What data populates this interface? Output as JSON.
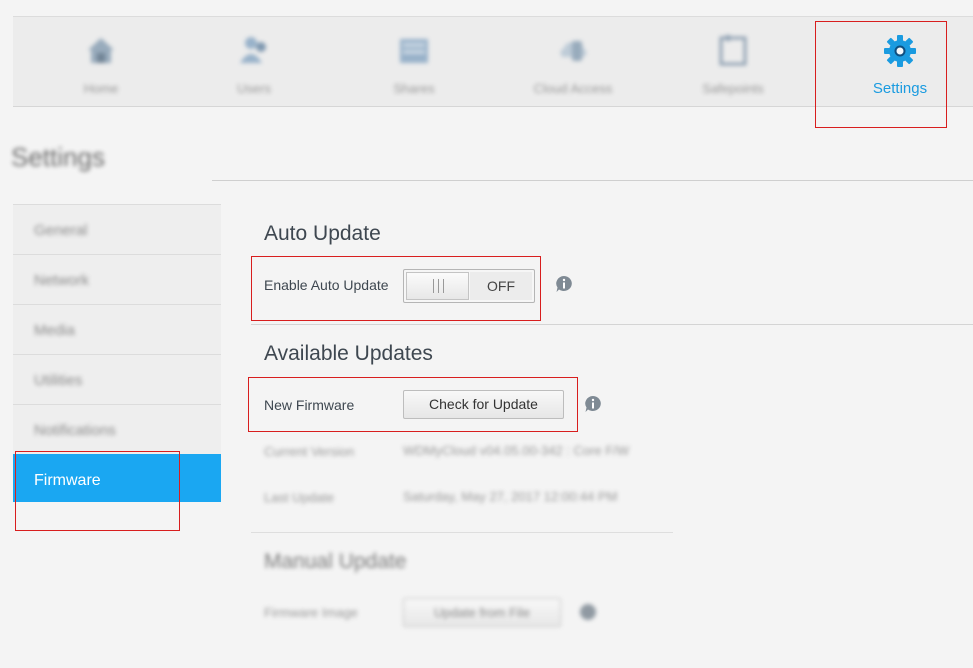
{
  "nav": {
    "items": [
      {
        "label": "Home",
        "icon": "home-icon"
      },
      {
        "label": "Users",
        "icon": "users-icon"
      },
      {
        "label": "Shares",
        "icon": "shares-icon"
      },
      {
        "label": "Cloud Access",
        "icon": "cloud-access-icon"
      },
      {
        "label": "Safepoints",
        "icon": "safepoints-icon"
      },
      {
        "label": "Settings",
        "icon": "gear-icon",
        "active": true
      }
    ]
  },
  "page": {
    "title": "Settings"
  },
  "sidebar": {
    "items": [
      {
        "label": "General"
      },
      {
        "label": "Network"
      },
      {
        "label": "Media"
      },
      {
        "label": "Utilities"
      },
      {
        "label": "Notifications"
      },
      {
        "label": "Firmware",
        "active": true
      }
    ]
  },
  "auto_update": {
    "title": "Auto Update",
    "label": "Enable Auto Update",
    "toggle_state": "OFF"
  },
  "available_updates": {
    "title": "Available Updates",
    "new_firmware_label": "New Firmware",
    "check_button": "Check for Update",
    "current_version_label": "Current Version",
    "current_version_value": "WDMyCloud v04.05.00-342 : Core F/W",
    "last_update_label": "Last Update",
    "last_update_value": "Saturday, May 27, 2017 12:00:44 PM"
  },
  "manual_update": {
    "title": "Manual Update",
    "firmware_image_label": "Firmware Image",
    "update_button": "Update from File"
  },
  "colors": {
    "accent": "#1aa7f2",
    "highlight_box": "#d81e1e",
    "active_nav": "#1a9be0"
  }
}
